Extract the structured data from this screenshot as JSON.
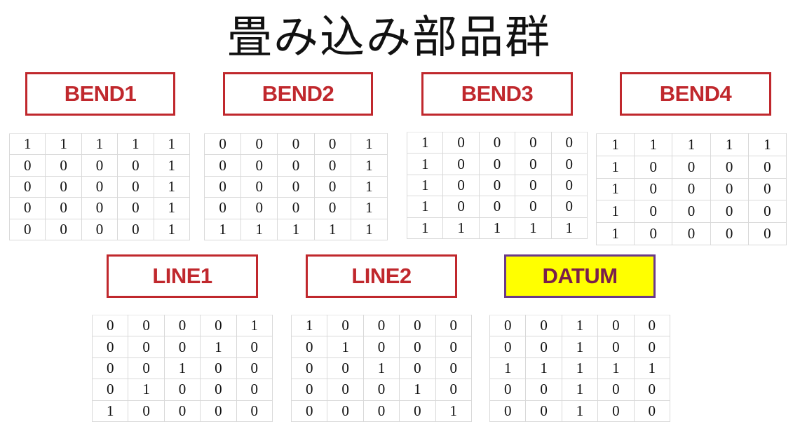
{
  "title": "畳み込み部品群",
  "groups": [
    {
      "label": "BEND1",
      "matrix": [
        [
          "1",
          "1",
          "1",
          "1",
          "1"
        ],
        [
          "0",
          "0",
          "0",
          "0",
          "1"
        ],
        [
          "0",
          "0",
          "0",
          "0",
          "1"
        ],
        [
          "0",
          "0",
          "0",
          "0",
          "1"
        ],
        [
          "0",
          "0",
          "0",
          "0",
          "1"
        ]
      ]
    },
    {
      "label": "BEND2",
      "matrix": [
        [
          "0",
          "0",
          "0",
          "0",
          "1"
        ],
        [
          "0",
          "0",
          "0",
          "0",
          "1"
        ],
        [
          "0",
          "0",
          "0",
          "0",
          "1"
        ],
        [
          "0",
          "0",
          "0",
          "0",
          "1"
        ],
        [
          "1",
          "1",
          "1",
          "1",
          "1"
        ]
      ]
    },
    {
      "label": "BEND3",
      "matrix": [
        [
          "1",
          "0",
          "0",
          "0",
          "0"
        ],
        [
          "1",
          "0",
          "0",
          "0",
          "0"
        ],
        [
          "1",
          "0",
          "0",
          "0",
          "0"
        ],
        [
          "1",
          "0",
          "0",
          "0",
          "0"
        ],
        [
          "1",
          "1",
          "1",
          "1",
          "1"
        ]
      ]
    },
    {
      "label": "BEND4",
      "matrix": [
        [
          "1",
          "1",
          "1",
          "1",
          "1"
        ],
        [
          "1",
          "0",
          "0",
          "0",
          "0"
        ],
        [
          "1",
          "0",
          "0",
          "0",
          "0"
        ],
        [
          "1",
          "0",
          "0",
          "0",
          "0"
        ],
        [
          "1",
          "0",
          "0",
          "0",
          "0"
        ]
      ]
    },
    {
      "label": "LINE1",
      "matrix": [
        [
          "0",
          "0",
          "0",
          "0",
          "1"
        ],
        [
          "0",
          "0",
          "0",
          "1",
          "0"
        ],
        [
          "0",
          "0",
          "1",
          "0",
          "0"
        ],
        [
          "0",
          "1",
          "0",
          "0",
          "0"
        ],
        [
          "1",
          "0",
          "0",
          "0",
          "0"
        ]
      ]
    },
    {
      "label": "LINE2",
      "matrix": [
        [
          "1",
          "0",
          "0",
          "0",
          "0"
        ],
        [
          "0",
          "1",
          "0",
          "0",
          "0"
        ],
        [
          "0",
          "0",
          "1",
          "0",
          "0"
        ],
        [
          "0",
          "0",
          "0",
          "1",
          "0"
        ],
        [
          "0",
          "0",
          "0",
          "0",
          "1"
        ]
      ]
    },
    {
      "label": "DATUM",
      "highlight_color": "#ffff00",
      "matrix": [
        [
          "0",
          "0",
          "1",
          "0",
          "0"
        ],
        [
          "0",
          "0",
          "1",
          "0",
          "0"
        ],
        [
          "1",
          "1",
          "1",
          "1",
          "1"
        ],
        [
          "0",
          "0",
          "1",
          "0",
          "0"
        ],
        [
          "0",
          "0",
          "1",
          "0",
          "0"
        ]
      ]
    }
  ],
  "colors": {
    "label_red": "#c0282d",
    "datum_fill": "#ffff00",
    "datum_border": "#6a3a8a",
    "datum_text": "#7a1f4a"
  }
}
